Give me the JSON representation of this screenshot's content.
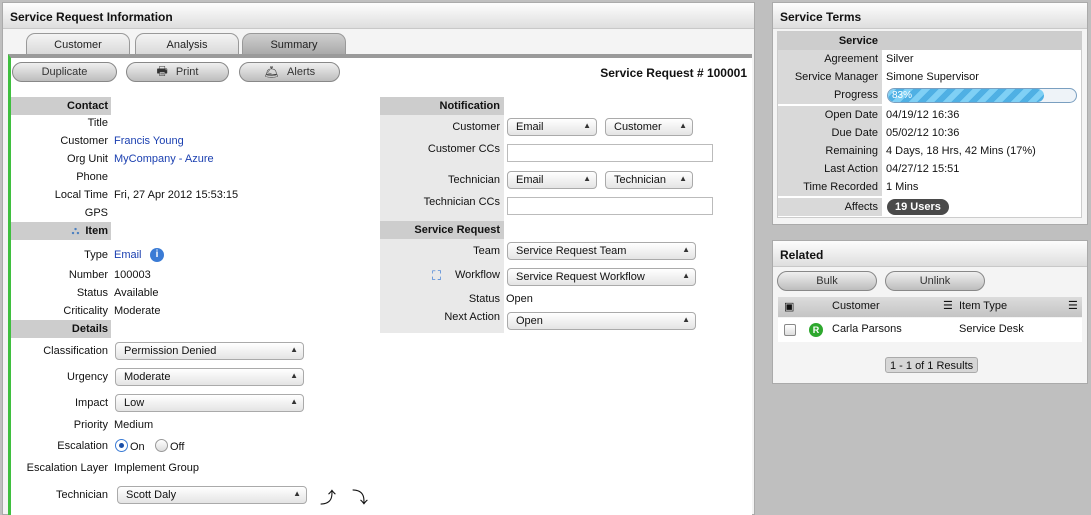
{
  "main_panel": {
    "title": "Service Request Information",
    "tabs": [
      {
        "label": "Customer"
      },
      {
        "label": "Analysis"
      },
      {
        "label": "Summary"
      }
    ],
    "toolbar": {
      "duplicate": "Duplicate",
      "print": "Print",
      "alerts": "Alerts"
    },
    "request_number": "Service Request # 100001",
    "contact": {
      "header": "Contact",
      "title_label": "Title",
      "title_value": "",
      "customer_label": "Customer",
      "customer_value": "Francis Young",
      "org_label": "Org Unit",
      "org_value": "MyCompany - Azure",
      "phone_label": "Phone",
      "phone_value": "",
      "time_label": "Local Time",
      "time_value": "Fri, 27 Apr 2012 15:53:15",
      "gps_label": "GPS",
      "gps_value": ""
    },
    "item": {
      "header": "Item",
      "type_label": "Type",
      "type_value": "Email",
      "number_label": "Number",
      "number_value": "100003",
      "status_label": "Status",
      "status_value": "Available",
      "criticality_label": "Criticality",
      "criticality_value": "Moderate"
    },
    "details": {
      "header": "Details",
      "classification_label": "Classification",
      "classification_value": "Permission Denied",
      "urgency_label": "Urgency",
      "urgency_value": "Moderate",
      "impact_label": "Impact",
      "impact_value": "Low",
      "priority_label": "Priority",
      "priority_value": "Medium",
      "escalation_label": "Escalation",
      "escalation_on": "On",
      "escalation_off": "Off",
      "layer_label": "Escalation Layer",
      "layer_value": "Implement Group",
      "technician_label": "Technician",
      "technician_value": "Scott Daly"
    },
    "notification": {
      "header": "Notification",
      "customer_label": "Customer",
      "customer_method": "Email",
      "customer_target": "Customer",
      "customer_ccs_label": "Customer CCs",
      "technician_label": "Technician",
      "technician_method": "Email",
      "technician_target": "Technician",
      "technician_ccs_label": "Technician CCs"
    },
    "service_request": {
      "header": "Service Request",
      "team_label": "Team",
      "team_value": "Service Request Team",
      "workflow_label": "Workflow",
      "workflow_value": "Service Request Workflow",
      "status_label": "Status",
      "status_value": "Open",
      "next_action_label": "Next Action",
      "next_action_value": "Open"
    }
  },
  "service_terms": {
    "title": "Service Terms",
    "service_header": "Service",
    "agreement_label": "Agreement",
    "agreement_value": "Silver",
    "manager_label": "Service Manager",
    "manager_value": "Simone Supervisor",
    "progress_label": "Progress",
    "progress_text": "83%",
    "progress_percent": 83,
    "open_label": "Open Date",
    "open_value": "04/19/12 16:36",
    "due_label": "Due Date",
    "due_value": "05/02/12 10:36",
    "remaining_label": "Remaining",
    "remaining_value": "4 Days, 18 Hrs, 42 Mins (17%)",
    "last_label": "Last Action",
    "last_value": "04/27/12 15:51",
    "recorded_label": "Time Recorded",
    "recorded_value": "1 Mins",
    "affects_label": "Affects",
    "affects_value": "19 Users"
  },
  "related": {
    "title": "Related",
    "bulk": "Bulk",
    "unlink": "Unlink",
    "col_customer": "Customer",
    "col_item_type": "Item Type",
    "rows": [
      {
        "badge": "R",
        "customer": "Carla Parsons",
        "item_type": "Service Desk"
      }
    ],
    "results": "1 - 1 of 1 Results"
  },
  "colors": {
    "accent_green": "#3fbf3f",
    "link_blue": "#1a3fb0",
    "progress_blue": "#5bb8e8",
    "badge_dark": "#4a4a4a"
  }
}
